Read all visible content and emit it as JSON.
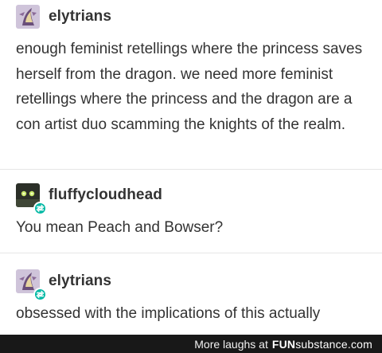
{
  "posts": [
    {
      "username": "elytrians",
      "text": "enough feminist retellings where the princess saves herself from the dragon. we need more feminist retellings where the princess and the dragon are a con artist duo scamming the knights of the realm.",
      "avatar": "dragon-art-avatar"
    },
    {
      "username": "fluffycloudhead",
      "text": "You mean Peach and Bowser?",
      "avatar": "dark-glowing-eyes-avatar",
      "badge": "reblog-icon"
    },
    {
      "username": "elytrians",
      "text": "obsessed with the implications of this actually",
      "avatar": "dragon-art-avatar",
      "badge": "reblog-icon"
    }
  ],
  "footer": {
    "prefix": "More laughs at",
    "brand_bold": "FUN",
    "brand_rest": "substance.com"
  },
  "colors": {
    "badge": "#00b8a4",
    "footer_bg": "#181818"
  }
}
